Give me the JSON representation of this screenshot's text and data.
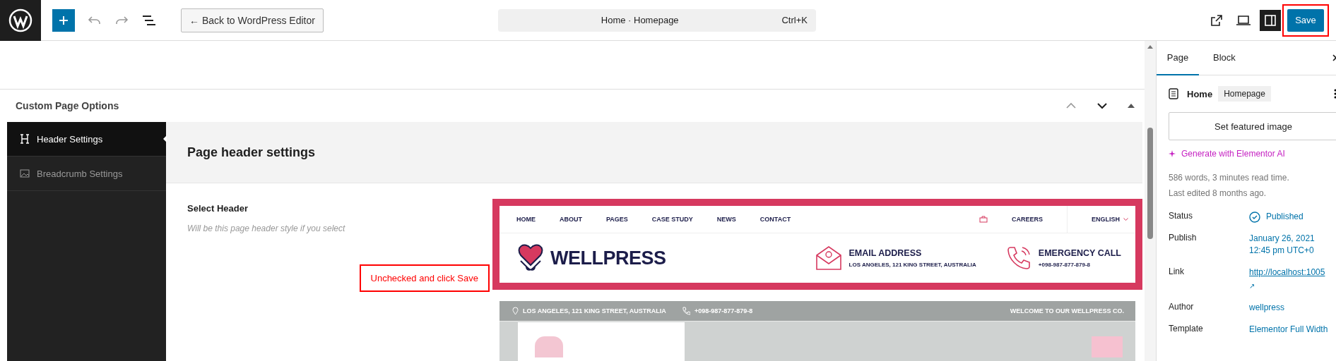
{
  "toolbar": {
    "back_button": "← Back to WordPress Editor",
    "command": {
      "title": "Home · Homepage",
      "shortcut": "Ctrl+K"
    },
    "sidebar_toggle_on": true,
    "save_button": "Save"
  },
  "options": {
    "title": "Custom Page Options",
    "menu": [
      {
        "label": "Header Settings",
        "kind": "heading",
        "selected": true
      },
      {
        "label": "Breadcrumb Settings",
        "kind": "image",
        "selected": false
      }
    ],
    "panel_title": "Page header settings",
    "field_label": "Select Header",
    "field_hint": "Will be this page header style if you select",
    "annotation": "Unchecked and click Save",
    "preview": {
      "nav": [
        "HOME",
        "ABOUT",
        "PAGES",
        "CASE STUDY",
        "NEWS",
        "CONTACT"
      ],
      "careers": "CAREERS",
      "language": "ENGLISH",
      "logo": "WELLPRESS",
      "contacts": [
        {
          "kind": "email",
          "title": "EMAIL ADDRESS",
          "detail": "LOS ANGELES, 121 KING STREET, AUSTRALIA"
        },
        {
          "kind": "phone",
          "title": "EMERGENCY CALL",
          "detail": "+098-987-877-879-8"
        }
      ],
      "selected": true
    },
    "preview_2": {
      "address": "LOS ANGELES, 121 KING STREET, AUSTRALIA",
      "phone": "+098-987-877-879-8",
      "welcome": "WELCOME TO OUR WELLPRESS CO."
    }
  },
  "sidebar": {
    "tabs": [
      {
        "label": "Page",
        "selected": true
      },
      {
        "label": "Block",
        "selected": false
      }
    ],
    "title": "Home",
    "badge": "Homepage",
    "featured_button": "Set featured image",
    "ai_link": "Generate with Elementor AI",
    "stats": [
      "586 words, 3 minutes read time.",
      "Last edited 8 months ago."
    ],
    "fields": [
      {
        "label": "Status",
        "kind": "status",
        "lines": [
          "Published"
        ]
      },
      {
        "label": "Publish",
        "kind": "text",
        "lines": [
          "January 26, 2021",
          "12:45 pm UTC+0"
        ]
      },
      {
        "label": "Link",
        "kind": "link",
        "lines": [
          "http://localhost:1005",
          "↗"
        ]
      },
      {
        "label": "Author",
        "kind": "text",
        "lines": [
          "wellpress"
        ]
      },
      {
        "label": "Template",
        "kind": "text",
        "lines": [
          "Elementor Full Width"
        ]
      }
    ]
  }
}
